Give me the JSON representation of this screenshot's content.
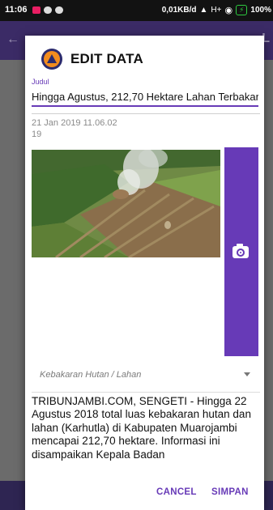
{
  "status_bar": {
    "time": "11:06",
    "network": "0,01KB/d",
    "signal": "H+",
    "battery": "100%"
  },
  "background_app": {
    "partial_title_char": "L"
  },
  "dialog": {
    "title": "EDIT DATA",
    "judul_label": "Judul",
    "judul_value": "Hingga Agustus, 212,70 Hektare Lahan Terbakar",
    "date": "21 Jan 2019 11.06.02",
    "number": "19",
    "category": "Kebakaran Hutan / Lahan",
    "body": "TRIBUNJAMBI.COM, SENGETI - Hingga 22 Agustus 2018 total luas kebakaran hutan dan lahan (Karhutla) di Kabupaten Muarojambi mencapai 212,70 hektare. Informasi ini disampaikan Kepala Badan",
    "cancel_label": "CANCEL",
    "save_label": "SIMPAN"
  },
  "icons": {
    "logo": "bnpb-logo-icon",
    "camera": "camera-icon",
    "dropdown": "dropdown-arrow-icon"
  },
  "colors": {
    "accent": "#673ab7",
    "status_bar": "#121212",
    "battery": "#2ecc40"
  }
}
